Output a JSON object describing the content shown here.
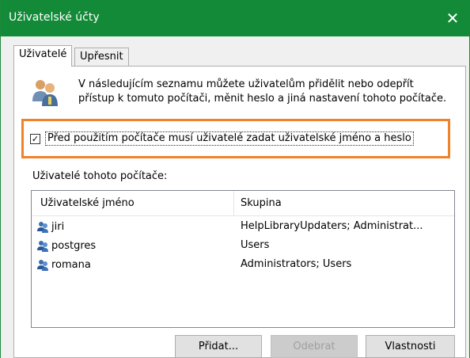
{
  "window": {
    "title": "Uživatelské účty",
    "close_glyph": "✕"
  },
  "tabs": [
    {
      "label": "Uživatelé",
      "active": true
    },
    {
      "label": "Upřesnit",
      "active": false
    }
  ],
  "intro": {
    "icon": "users-group-icon",
    "text": "V následujícím seznamu můžete uživatelům přidělit nebo odepřít přístup k tomuto počítači, měnit heslo a jiná nastavení tohoto počítače."
  },
  "require_login": {
    "checked": true,
    "check_glyph": "✓",
    "label": "Před použitím počítače musí uživatelé zadat uživatelské jméno a heslo"
  },
  "users_list": {
    "label": "Uživatelé tohoto počítače:",
    "columns": [
      "Uživatelské jméno",
      "Skupina"
    ],
    "rows": [
      {
        "name": "jiri",
        "group": "HelpLibraryUpdaters; Administrat..."
      },
      {
        "name": "postgres",
        "group": "Users"
      },
      {
        "name": "romana",
        "group": "Administrators; Users"
      }
    ]
  },
  "buttons": {
    "add": "Přidat...",
    "remove": "Odebrat",
    "properties": "Vlastnosti"
  },
  "colors": {
    "titlebar": "#128a37",
    "highlight": "#f0822a"
  }
}
